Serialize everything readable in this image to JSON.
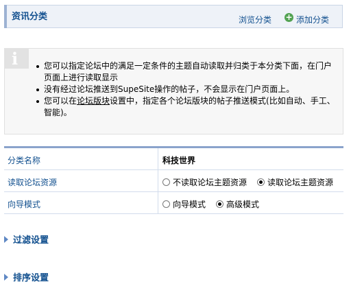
{
  "header": {
    "title": "资讯分类",
    "browse_label": "浏览分类",
    "add_label": "添加分类"
  },
  "info": {
    "badge": "i",
    "bullets": [
      "您可以指定论坛中的满足一定条件的主题自动读取并归类于本分类下面，在门户页面上进行读取显示",
      "没有经过论坛推送到SupeSite操作的帖子，不会显示在门户页面上。"
    ],
    "bullet3": {
      "pre": "您可以在",
      "link": "论坛版块",
      "post": "设置中，指定各个论坛版块的帖子推送模式(比如自动、手工、智能)。"
    }
  },
  "form": {
    "category_name_label": "分类名称",
    "category_name_value": "科技世界",
    "read_resource_label": "读取论坛资源",
    "read_options": [
      "不读取论坛主题资源",
      "读取论坛主题资源"
    ],
    "read_selected": "读取论坛主题资源",
    "mode_label": "向导模式",
    "mode_options": [
      "向导模式",
      "高级模式"
    ],
    "mode_selected": "高级模式"
  },
  "sections": {
    "filter": "过滤设置",
    "sort": "排序设置"
  },
  "colors": {
    "link": "#12508f",
    "header_bg": "#eef2f8",
    "table_top": "#8aa3cc",
    "info_bg": "#f7f7f7"
  }
}
